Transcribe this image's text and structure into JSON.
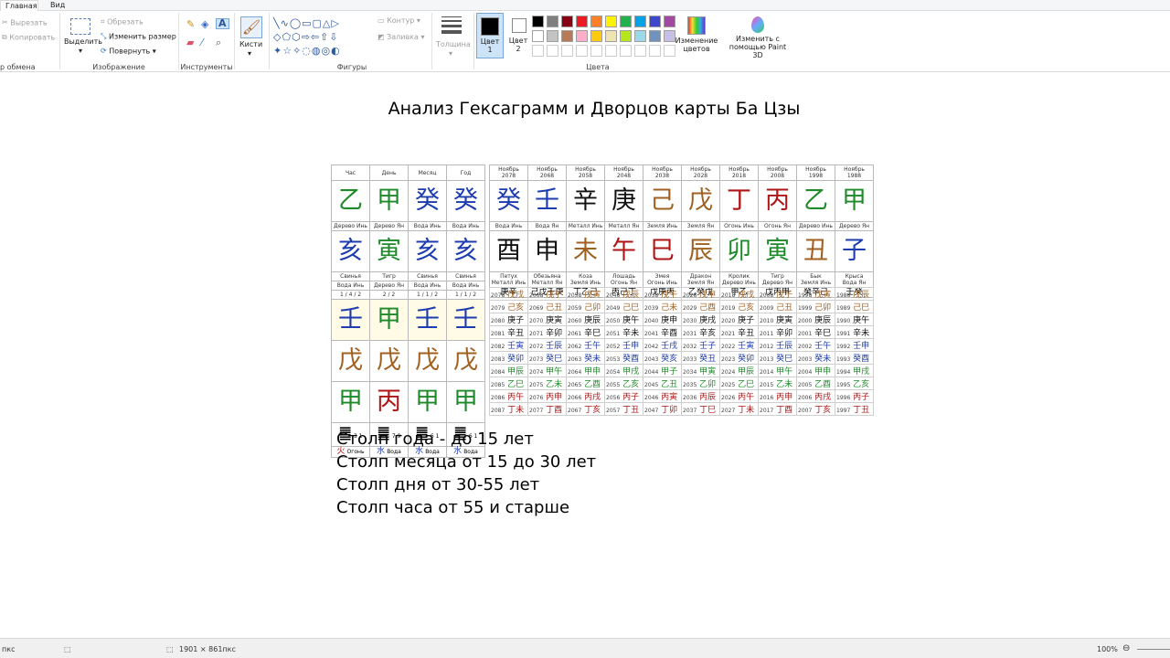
{
  "tabs": [
    "Главная",
    "Вид"
  ],
  "ribbon": {
    "clipboard": {
      "cut": "Вырезать",
      "copy": "Копировать",
      "label": "р обмена"
    },
    "image": {
      "select": "Выделить",
      "crop": "Обрезать",
      "resize": "Изменить размер",
      "rotate": "Повернуть",
      "label": "Изображение"
    },
    "tools": {
      "label": "Инструменты"
    },
    "brushes": {
      "label": "Кисти"
    },
    "shapes": {
      "outline": "Контур",
      "fill": "Заливка",
      "label": "Фигуры"
    },
    "size": {
      "label": "Толщина"
    },
    "colors": {
      "color1": "Цвет 1",
      "color2": "Цвет 2",
      "edit": "Изменение цветов",
      "paint3d": "Изменить с помощью Paint 3D",
      "label": "Цвета",
      "palette": [
        "#000000",
        "#7f7f7f",
        "#880015",
        "#ed1c24",
        "#ff7f27",
        "#fff200",
        "#22b14c",
        "#00a2e8",
        "#3f48cc",
        "#a349a4",
        "#ffffff",
        "#c3c3c3",
        "#b97a57",
        "#ffaec9",
        "#ffc90e",
        "#efe4b0",
        "#b5e61d",
        "#99d9ea",
        "#7092be",
        "#c8bfe7"
      ]
    }
  },
  "doc_title": "Анализ Гексаграмм и Дворцов карты Ба Цзы",
  "pillars": {
    "headers": [
      "Час",
      "День",
      "Месяц",
      "Год"
    ],
    "stems": [
      {
        "ch": "乙",
        "c": "green"
      },
      {
        "ch": "甲",
        "c": "green"
      },
      {
        "ch": "癸",
        "c": "blue"
      },
      {
        "ch": "癸",
        "c": "blue"
      }
    ],
    "stem_labels": [
      "Дерево Инь",
      "Дерево Ян",
      "Вода Инь",
      "Вода Инь"
    ],
    "branches": [
      {
        "ch": "亥",
        "c": "blue"
      },
      {
        "ch": "寅",
        "c": "green"
      },
      {
        "ch": "亥",
        "c": "blue"
      },
      {
        "ch": "亥",
        "c": "blue"
      }
    ],
    "animals": [
      "Свинья",
      "Тигр",
      "Свинья",
      "Свинья"
    ],
    "branch_labels": [
      "Вода Инь",
      "Дерево Ян",
      "Вода Инь",
      "Вода Инь"
    ],
    "fractions": [
      "1 / 4 / 2",
      "2 / 2",
      "1 / 1 / 2",
      "1 / 1 / 2"
    ],
    "hidden1": [
      {
        "ch": "壬",
        "c": "blue"
      },
      {
        "ch": "甲",
        "c": "green"
      },
      {
        "ch": "壬",
        "c": "blue"
      },
      {
        "ch": "壬",
        "c": "blue"
      }
    ],
    "hidden2": [
      {
        "ch": "戊",
        "c": "brown"
      },
      {
        "ch": "戊",
        "c": "brown"
      },
      {
        "ch": "戊",
        "c": "brown"
      },
      {
        "ch": "戊",
        "c": "brown"
      }
    ],
    "hidden3": [
      {
        "ch": "甲",
        "c": "green"
      },
      {
        "ch": "丙",
        "c": "red"
      },
      {
        "ch": "甲",
        "c": "green"
      },
      {
        "ch": "甲",
        "c": "green"
      }
    ],
    "hexnums": [
      [
        "3",
        "1"
      ],
      [
        "7",
        "9"
      ],
      [
        "6",
        "1"
      ],
      [
        "6",
        "1"
      ]
    ],
    "elements": [
      {
        "ch": "火",
        "t": "Огонь",
        "c": "red"
      },
      {
        "ch": "水",
        "t": "Вода",
        "c": "blue"
      },
      {
        "ch": "水",
        "t": "Вода",
        "c": "blue"
      },
      {
        "ch": "水",
        "t": "Вода",
        "c": "blue"
      }
    ]
  },
  "luck": {
    "months": [
      "Ноябрь",
      "Ноябрь",
      "Ноябрь",
      "Ноябрь",
      "Ноябрь",
      "Ноябрь",
      "Ноябрь",
      "Ноябрь",
      "Ноябрь",
      "Ноябрь"
    ],
    "years": [
      "2078",
      "2068",
      "2058",
      "2048",
      "2038",
      "2028",
      "2018",
      "2008",
      "1998",
      "1988"
    ],
    "stems": [
      {
        "ch": "癸",
        "c": "blue"
      },
      {
        "ch": "壬",
        "c": "blue"
      },
      {
        "ch": "辛",
        "c": "black"
      },
      {
        "ch": "庚",
        "c": "black"
      },
      {
        "ch": "己",
        "c": "brown"
      },
      {
        "ch": "戊",
        "c": "brown"
      },
      {
        "ch": "丁",
        "c": "red"
      },
      {
        "ch": "丙",
        "c": "red"
      },
      {
        "ch": "乙",
        "c": "green"
      },
      {
        "ch": "甲",
        "c": "green"
      }
    ],
    "stem_labels": [
      "Вода Инь",
      "Вода Ян",
      "Металл Инь",
      "Металл Ян",
      "Земля Инь",
      "Земля Ян",
      "Огонь Инь",
      "Огонь Ян",
      "Дерево Инь",
      "Дерево Ян"
    ],
    "branches": [
      {
        "ch": "酉",
        "c": "black"
      },
      {
        "ch": "申",
        "c": "black"
      },
      {
        "ch": "未",
        "c": "brown"
      },
      {
        "ch": "午",
        "c": "red"
      },
      {
        "ch": "巳",
        "c": "red"
      },
      {
        "ch": "辰",
        "c": "brown"
      },
      {
        "ch": "卯",
        "c": "green"
      },
      {
        "ch": "寅",
        "c": "green"
      },
      {
        "ch": "丑",
        "c": "brown"
      },
      {
        "ch": "子",
        "c": "blue"
      }
    ],
    "animals": [
      "Петух",
      "Обезьяна",
      "Коза",
      "Лошадь",
      "Змея",
      "Дракон",
      "Кролик",
      "Тигр",
      "Бык",
      "Крыса"
    ],
    "branch_labels": [
      "Металл Инь",
      "Металл Ян",
      "Земля Инь",
      "Огонь Ян",
      "Огонь Инь",
      "Земля Ян",
      "Дерево Инь",
      "Дерево Ян",
      "Земля Инь",
      "Вода Ян"
    ],
    "hidden": [
      "庚辛",
      "己戊壬庚",
      "丁乙己",
      "丙己丁",
      "戊庚丙",
      "乙癸戊",
      "甲乙",
      "戊丙甲",
      "癸辛己",
      "壬癸"
    ]
  },
  "year_grid": [
    [
      "2078 戊戌",
      "2068 戊子",
      "2058 戊寅",
      "2048 戊辰",
      "2038 戊午",
      "2028 戊申",
      "2018 戊戌",
      "2008 戊子",
      "1998 戊寅",
      "1988 戊辰"
    ],
    [
      "2079 己亥",
      "2069 己丑",
      "2059 己卯",
      "2049 己巳",
      "2039 己未",
      "2029 己酉",
      "2019 己亥",
      "2009 己丑",
      "1999 己卯",
      "1989 己巳"
    ],
    [
      "2080 庚子",
      "2070 庚寅",
      "2060 庚辰",
      "2050 庚午",
      "2040 庚申",
      "2030 庚戌",
      "2020 庚子",
      "2010 庚寅",
      "2000 庚辰",
      "1990 庚午"
    ],
    [
      "2081 辛丑",
      "2071 辛卯",
      "2061 辛巳",
      "2051 辛未",
      "2041 辛酉",
      "2031 辛亥",
      "2021 辛丑",
      "2011 辛卯",
      "2001 辛巳",
      "1991 辛未"
    ],
    [
      "2082 壬寅",
      "2072 壬辰",
      "2062 壬午",
      "2052 壬申",
      "2042 壬戌",
      "2032 壬子",
      "2022 壬寅",
      "2012 壬辰",
      "2002 壬午",
      "1992 壬申"
    ],
    [
      "2083 癸卯",
      "2073 癸巳",
      "2063 癸未",
      "2053 癸酉",
      "2043 癸亥",
      "2033 癸丑",
      "2023 癸卯",
      "2013 癸巳",
      "2003 癸未",
      "1993 癸酉"
    ],
    [
      "2084 甲辰",
      "2074 甲午",
      "2064 甲申",
      "2054 甲戌",
      "2044 甲子",
      "2034 甲寅",
      "2024 甲辰",
      "2014 甲午",
      "2004 甲申",
      "1994 甲戌"
    ],
    [
      "2085 乙巳",
      "2075 乙未",
      "2065 乙酉",
      "2055 乙亥",
      "2045 乙丑",
      "2035 乙卯",
      "2025 乙巳",
      "2015 乙未",
      "2005 乙酉",
      "1995 乙亥"
    ],
    [
      "2086 丙午",
      "2076 丙申",
      "2066 丙戌",
      "2056 丙子",
      "2046 丙寅",
      "2036 丙辰",
      "2026 丙午",
      "2016 丙申",
      "2006 丙戌",
      "1996 丙子"
    ],
    [
      "2087 丁未",
      "2077 丁酉",
      "2067 丁亥",
      "2057 丁丑",
      "2047 丁卯",
      "2037 丁巳",
      "2027 丁未",
      "2017 丁酉",
      "2007 丁亥",
      "1997 丁丑"
    ]
  ],
  "notes": [
    "Столп года - до 15 лет",
    "Столп месяца от 15 до 30 лет",
    "Столп дня от 30-55 лет",
    "Столп часа от 55 и старше"
  ],
  "status": {
    "left": "пкс",
    "size": "1901 × 861пкс",
    "zoom": "100%"
  }
}
